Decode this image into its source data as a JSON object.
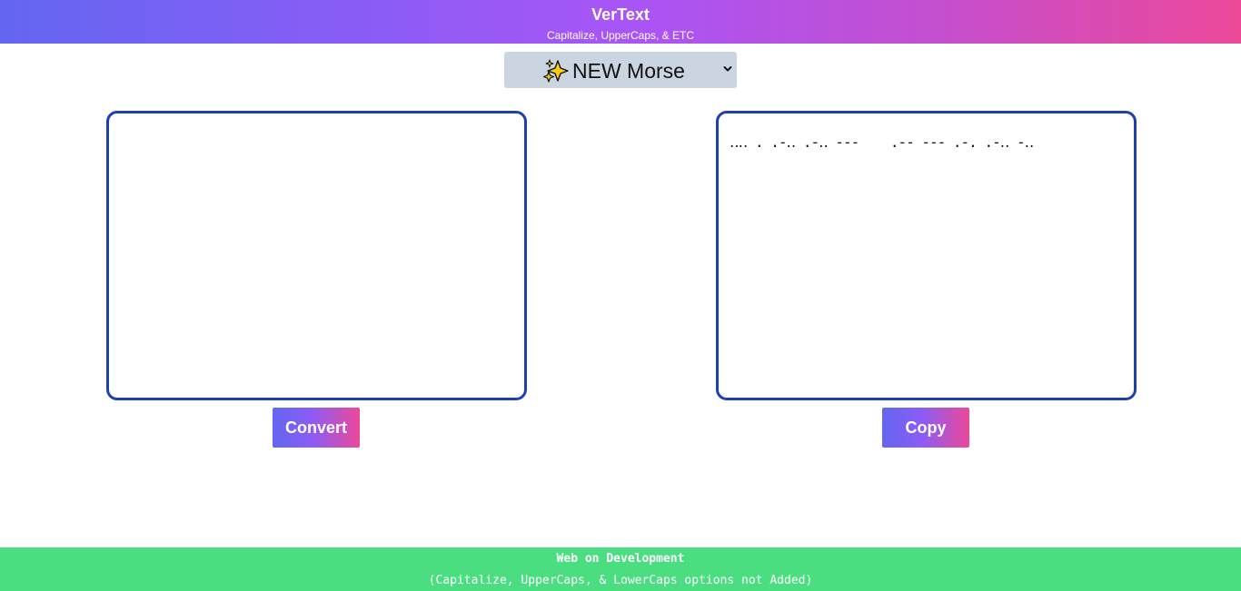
{
  "header": {
    "title": "VerText",
    "subtitle": "Capitalize, UpperCaps, & ETC"
  },
  "mode_select": {
    "icon": "sparkles-icon",
    "selected": "NEW Morse"
  },
  "input": {
    "value": ""
  },
  "output": {
    "value": "‥‥ . .-‥ .-‥ ---    .-- --- .-. .-‥ -‥"
  },
  "buttons": {
    "convert_label": "Convert",
    "copy_label": "Copy"
  },
  "footer": {
    "status": "Web on Development",
    "note": "(Capitalize, UpperCaps, & LowerCaps options not Added)"
  },
  "colors": {
    "header_gradient_start": "#6366f1",
    "header_gradient_end": "#ec4899",
    "textbox_border": "#1e40af",
    "select_bg": "#cbd5e1",
    "footer_bg": "#4ade80"
  }
}
